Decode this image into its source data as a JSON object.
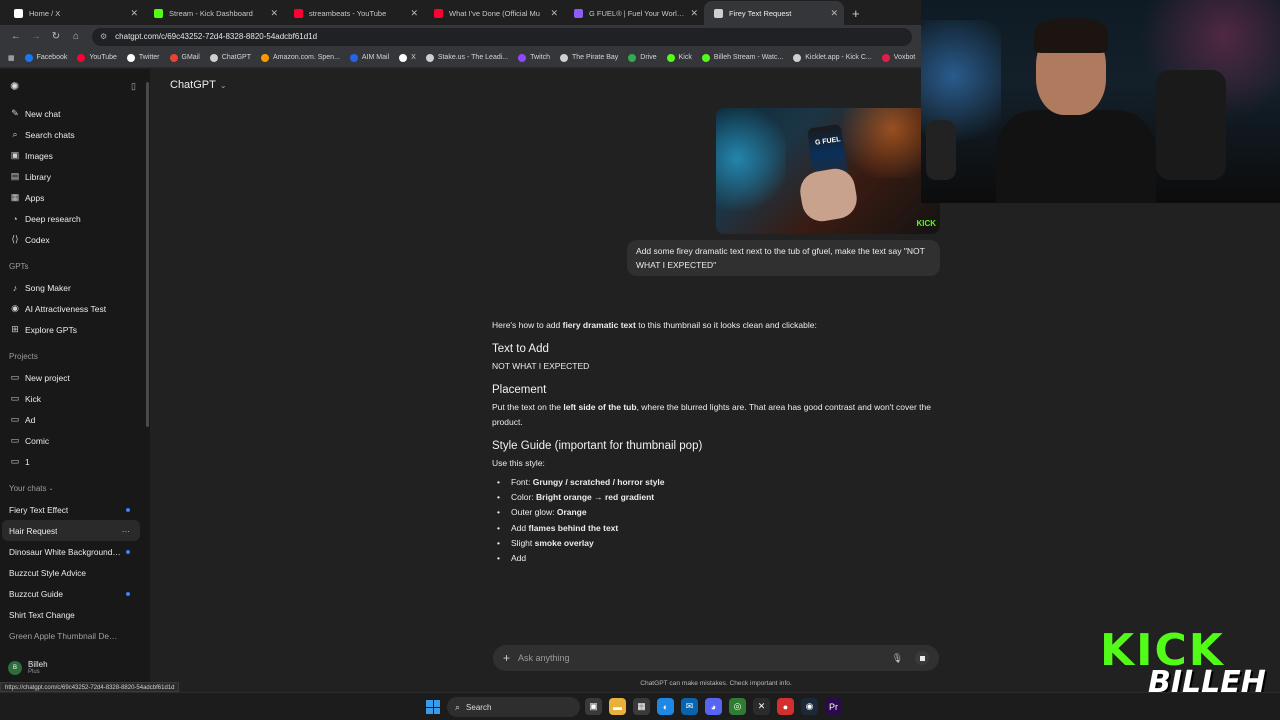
{
  "browser": {
    "tabs": [
      {
        "title": "Home / X",
        "color": "#ffffff",
        "icon": "x-logo-icon"
      },
      {
        "title": "Stream - Kick Dashboard",
        "color": "#53fc18",
        "icon": "kick-icon"
      },
      {
        "title": "streambeats - YouTube",
        "color": "#ff0033",
        "icon": "youtube-icon"
      },
      {
        "title": "What I've Done (Official Mu",
        "color": "#ff0033",
        "icon": "youtube-icon"
      },
      {
        "title": "G FUEL® | Fuel Your Worlds wi",
        "color": "#8b5cf6",
        "icon": "gfuel-icon"
      },
      {
        "title": "Firey Text Request",
        "color": "#cfcfcf",
        "icon": "chatgpt-icon"
      }
    ],
    "url": "chatgpt.com/c/69c43252-72d4-8328-8820-54adcbf61d1d",
    "bookmarks": [
      {
        "label": "Facebook",
        "color": "#1877f2"
      },
      {
        "label": "YouTube",
        "color": "#ff0033"
      },
      {
        "label": "Twitter",
        "color": "#ffffff"
      },
      {
        "label": "GMail",
        "color": "#ea4335"
      },
      {
        "label": "ChatGPT",
        "color": "#cfcfcf"
      },
      {
        "label": "Amazon.com. Spen...",
        "color": "#ff9900"
      },
      {
        "label": "AIM Mail",
        "color": "#2563eb"
      },
      {
        "label": "X",
        "color": "#ffffff"
      },
      {
        "label": "Stake.us - The Leadi...",
        "color": "#cfcfcf"
      },
      {
        "label": "Twitch",
        "color": "#9146ff"
      },
      {
        "label": "The Pirate Bay",
        "color": "#cfcfcf"
      },
      {
        "label": "Drive",
        "color": "#34a853"
      },
      {
        "label": "Kick",
        "color": "#53fc18"
      },
      {
        "label": "Billeh Stream - Watc...",
        "color": "#53fc18"
      },
      {
        "label": "Kicklet.app - Kick C...",
        "color": "#cfcfcf"
      },
      {
        "label": "Voxbot",
        "color": "#e11d48"
      }
    ],
    "status_url": "https://chatgpt.com/c/69c43252-72d4-8328-8820-54adcbf61d1d"
  },
  "sidebar": {
    "top_items": [
      {
        "label": "New chat",
        "icon": "edit-icon"
      },
      {
        "label": "Search chats",
        "icon": "search-icon"
      },
      {
        "label": "Images",
        "icon": "image-icon"
      },
      {
        "label": "Library",
        "icon": "library-icon"
      },
      {
        "label": "Apps",
        "icon": "apps-icon"
      },
      {
        "label": "Deep research",
        "icon": "telescope-icon"
      },
      {
        "label": "Codex",
        "icon": "codex-icon"
      }
    ],
    "gpts_heading": "GPTs",
    "gpts": [
      {
        "label": "Song Maker"
      },
      {
        "label": "AI Attractiveness Test"
      },
      {
        "label": "Explore GPTs"
      }
    ],
    "projects_heading": "Projects",
    "projects": [
      {
        "label": "New project"
      },
      {
        "label": "Kick"
      },
      {
        "label": "Ad"
      },
      {
        "label": "Comic"
      },
      {
        "label": "1"
      }
    ],
    "chats_heading": "Your chats",
    "chats": [
      {
        "label": "Fiery Text Effect",
        "unread": true
      },
      {
        "label": "Hair Request",
        "unread": false
      },
      {
        "label": "Dinosaur White Background ...",
        "unread": true
      },
      {
        "label": "Buzzcut Style Advice",
        "unread": false
      },
      {
        "label": "Buzzcut Guide",
        "unread": true
      },
      {
        "label": "Shirt Text Change",
        "unread": false
      },
      {
        "label": "Green Apple Thumbnail Design",
        "unread": false
      }
    ],
    "user": {
      "name": "Billeh",
      "plan": "Plus",
      "initials": "B"
    }
  },
  "main": {
    "model": "ChatGPT",
    "image_caption": "G FUEL",
    "image_badge": "KICK",
    "user_message": "Add some firey dramatic text next to the tub of gfuel, make the text say \"NOT WHAT I EXPECTED\"",
    "answer": {
      "intro_a": "Here's how to add ",
      "intro_b": "fiery dramatic text",
      "intro_c": " to this thumbnail so it looks clean and clickable:",
      "h1": "Text to Add",
      "text_value": "NOT WHAT I EXPECTED",
      "h2": "Placement",
      "placement_a": "Put the text on the ",
      "placement_b": "left side of the tub",
      "placement_c": ", where the blurred lights are. That area has good contrast and won't cover the product.",
      "h3": "Style Guide (important for thumbnail pop)",
      "style_intro": "Use this style:",
      "bullets": [
        {
          "k": "Font: ",
          "v": "Grungy / scratched / horror style"
        },
        {
          "k": "Color: ",
          "v": "Bright orange → red gradient"
        },
        {
          "k": "Outer glow: ",
          "v": "Orange"
        },
        {
          "k": "Add ",
          "v": "flames behind the text"
        },
        {
          "k": "Slight ",
          "v": "smoke overlay"
        },
        {
          "k": "Add",
          "v": ""
        }
      ]
    },
    "composer_placeholder": "Ask anything",
    "disclaimer": "ChatGPT can make mistakes. Check important info."
  },
  "overlay": {
    "brand_top": "KICK",
    "brand_bottom": "BILLEH"
  },
  "taskbar": {
    "search_label": "Search",
    "icons": [
      {
        "name": "task-view-icon",
        "color": "#3a3a3a"
      },
      {
        "name": "file-explorer-icon",
        "color": "#e8b23a"
      },
      {
        "name": "store-icon",
        "color": "#3a3a3a"
      },
      {
        "name": "edge-icon",
        "color": "#1e88e5"
      },
      {
        "name": "outlook-icon",
        "color": "#0a64ad"
      },
      {
        "name": "discord-icon",
        "color": "#5865f2"
      },
      {
        "name": "chrome-icon",
        "color": "#2e7d32"
      },
      {
        "name": "x-app-icon",
        "color": "#2b2b2b"
      },
      {
        "name": "recorder-icon",
        "color": "#d32f2f"
      },
      {
        "name": "steam-icon",
        "color": "#1b2838"
      },
      {
        "name": "premiere-icon",
        "color": "#2a0a4a"
      }
    ]
  }
}
